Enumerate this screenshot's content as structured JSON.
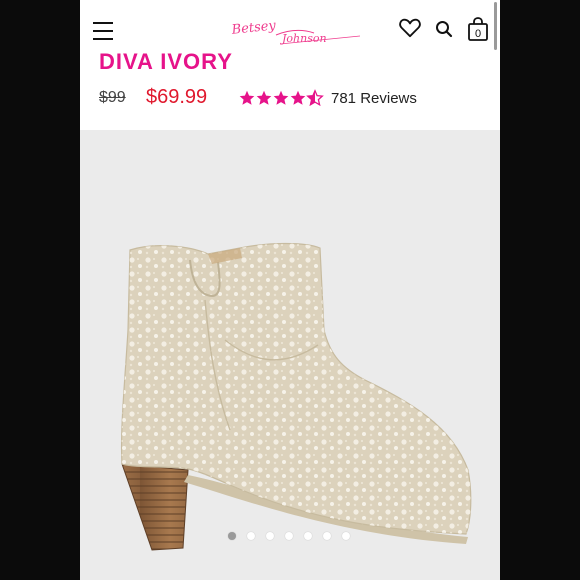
{
  "brand": {
    "logo_text": "Betsey Johnson"
  },
  "header": {
    "menu_icon": "hamburger-menu-icon",
    "wishlist_icon": "heart-icon",
    "search_icon": "search-icon",
    "cart_icon": "shopping-bag-icon",
    "cart_count": "0"
  },
  "product": {
    "name": "DIVA IVORY",
    "original_price": "$99",
    "sale_price": "$69.99",
    "rating": 4.5,
    "rating_max": 5,
    "reviews_label": "781 Reviews"
  },
  "gallery": {
    "image_subject": "Ivory pearl-studded western ankle boot with stacked wooden heel",
    "slide_count": 7,
    "active_slide": 1
  },
  "colors": {
    "accent_pink": "#e6138a",
    "sale_red": "#e0182d",
    "gallery_bg": "#ebebeb",
    "boot_ivory": "#dcd2bc",
    "heel_wood": "#9c6f47"
  }
}
